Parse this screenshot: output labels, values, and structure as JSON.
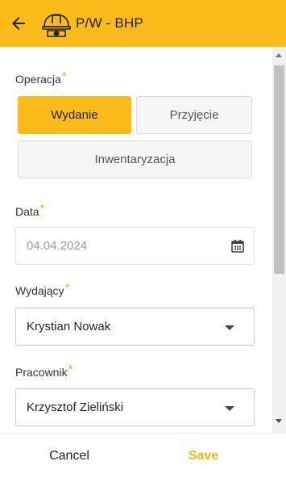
{
  "header": {
    "title": "P/W - BHP",
    "back_icon": "arrow-left-icon",
    "app_icon": "safety-helmet-icon",
    "background_color": "#FBBC1B"
  },
  "form": {
    "operation": {
      "label": "Operacja",
      "required_mark": "*",
      "options": [
        "Wydanie",
        "Przyjęcie",
        "Inwentaryzacja"
      ],
      "selected": "Wydanie"
    },
    "date": {
      "label": "Data",
      "required_mark": "*",
      "value": "04.04.2024",
      "icon": "calendar-icon"
    },
    "issuer": {
      "label": "Wydający",
      "required_mark": "*",
      "value": "Krystian Nowak"
    },
    "employee": {
      "label": "Pracownik",
      "required_mark": "*",
      "value": "Krzysztof Zieliński"
    }
  },
  "footer": {
    "cancel_label": "Cancel",
    "save_label": "Save",
    "save_color": "#F6B41F"
  }
}
